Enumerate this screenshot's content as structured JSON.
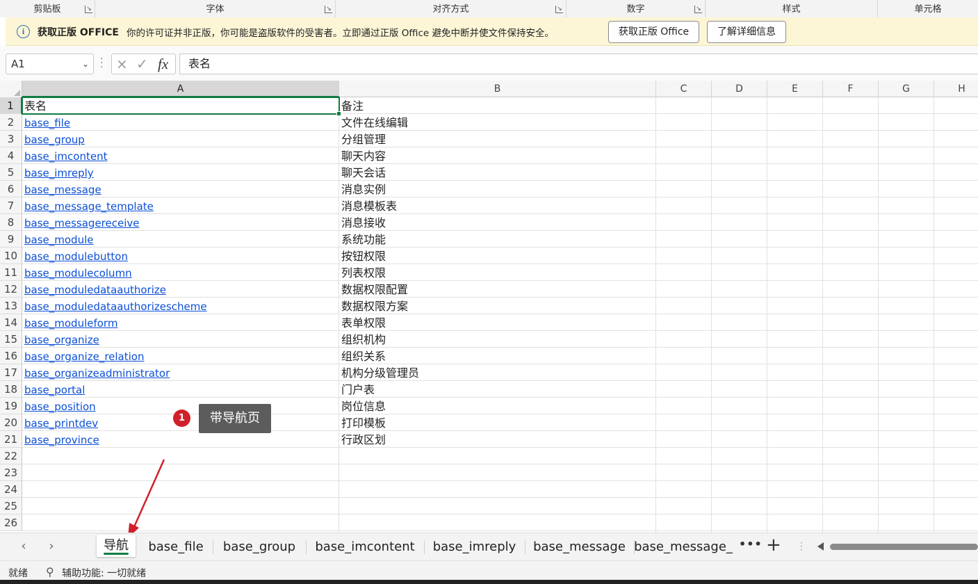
{
  "ribbon": {
    "groups": [
      "剪贴板",
      "字体",
      "对齐方式",
      "数字",
      "样式",
      "单元格"
    ],
    "launcher_icon": "dialog-launcher-icon"
  },
  "message_bar": {
    "icon": "info-icon",
    "title": "获取正版 OFFICE",
    "text": "你的许可证并非正版，你可能是盗版软件的受害者。立即通过正版 Office 避免中断并使文件保持安全。",
    "btn_genuine": "获取正版 Office",
    "btn_learn": "了解详细信息"
  },
  "formula_bar": {
    "name_box": "A1",
    "cancel_icon": "×",
    "enter_icon": "✓",
    "fx_label": "fx",
    "value": "表名"
  },
  "columns": [
    "A",
    "B",
    "C",
    "D",
    "E",
    "F",
    "G",
    "H"
  ],
  "rows": [
    {
      "num": "1",
      "a": "表名",
      "b": "备注",
      "link": false
    },
    {
      "num": "2",
      "a": "base_file",
      "b": "文件在线编辑",
      "link": true
    },
    {
      "num": "3",
      "a": "base_group",
      "b": "分组管理",
      "link": true
    },
    {
      "num": "4",
      "a": "base_imcontent",
      "b": "聊天内容",
      "link": true
    },
    {
      "num": "5",
      "a": "base_imreply",
      "b": "聊天会话",
      "link": true
    },
    {
      "num": "6",
      "a": "base_message",
      "b": "消息实例",
      "link": true
    },
    {
      "num": "7",
      "a": "base_message_template",
      "b": "消息模板表",
      "link": true
    },
    {
      "num": "8",
      "a": "base_messagereceive",
      "b": "消息接收",
      "link": true
    },
    {
      "num": "9",
      "a": "base_module",
      "b": "系统功能",
      "link": true
    },
    {
      "num": "10",
      "a": "base_modulebutton",
      "b": "按钮权限",
      "link": true
    },
    {
      "num": "11",
      "a": "base_modulecolumn",
      "b": "列表权限",
      "link": true
    },
    {
      "num": "12",
      "a": "base_moduledataauthorize",
      "b": "数据权限配置",
      "link": true
    },
    {
      "num": "13",
      "a": "base_moduledataauthorizescheme",
      "b": "数据权限方案",
      "link": true
    },
    {
      "num": "14",
      "a": "base_moduleform",
      "b": "表单权限",
      "link": true
    },
    {
      "num": "15",
      "a": "base_organize",
      "b": "组织机构",
      "link": true
    },
    {
      "num": "16",
      "a": "base_organize_relation",
      "b": "组织关系",
      "link": true
    },
    {
      "num": "17",
      "a": "base_organizeadministrator",
      "b": "机构分级管理员",
      "link": true
    },
    {
      "num": "18",
      "a": "base_portal",
      "b": "门户表",
      "link": true
    },
    {
      "num": "19",
      "a": "base_position",
      "b": "岗位信息",
      "link": true
    },
    {
      "num": "20",
      "a": "base_printdev",
      "b": "打印模板",
      "link": true
    },
    {
      "num": "21",
      "a": "base_province",
      "b": "行政区划",
      "link": true
    },
    {
      "num": "22",
      "a": "",
      "b": "",
      "link": false
    },
    {
      "num": "23",
      "a": "",
      "b": "",
      "link": false
    },
    {
      "num": "24",
      "a": "",
      "b": "",
      "link": false
    },
    {
      "num": "25",
      "a": "",
      "b": "",
      "link": false
    },
    {
      "num": "26",
      "a": "",
      "b": "",
      "link": false
    }
  ],
  "annotation": {
    "badge": "1",
    "label": "带导航页",
    "accent": "#d0202a"
  },
  "sheet_tabs": {
    "prev_icon": "‹",
    "next_icon": "›",
    "tabs": [
      "导航",
      "base_file",
      "base_group",
      "base_imcontent",
      "base_imreply",
      "base_message",
      "base_message_"
    ],
    "active_index": 0,
    "more": "•••",
    "add": "+"
  },
  "status_bar": {
    "ready": "就绪",
    "accessibility": "辅助功能: 一切就绪",
    "accessibility_icon": "accessibility-icon"
  },
  "colors": {
    "accent_green": "#107c41",
    "link_blue": "#0b4fd6",
    "message_bg": "#fdf6d6"
  }
}
